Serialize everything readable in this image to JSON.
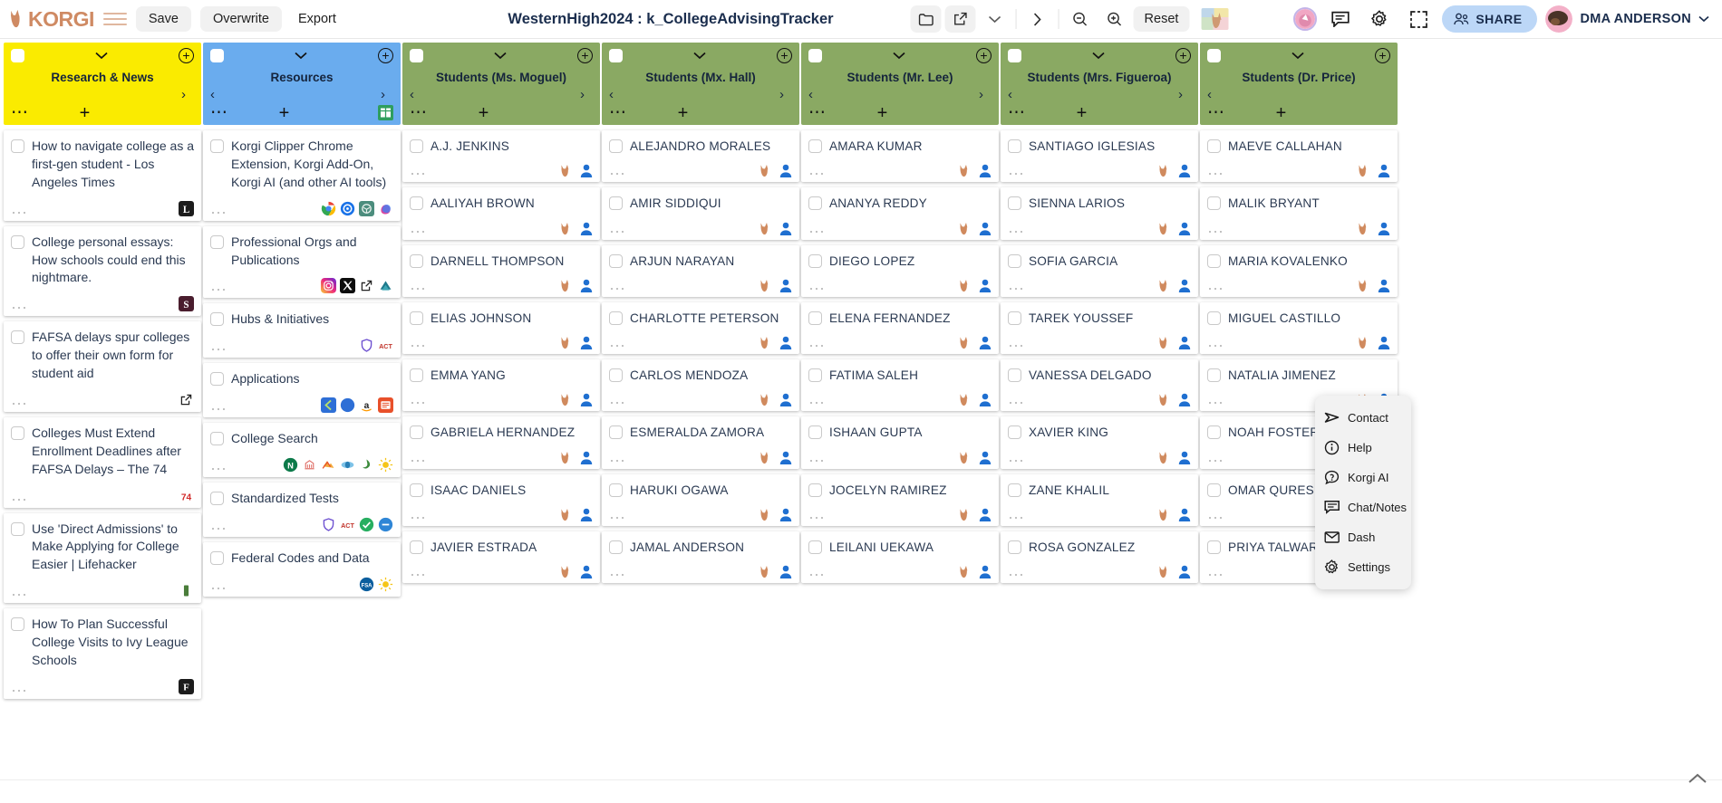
{
  "topbar": {
    "brand": "KORGI",
    "brand_icon": "fox-logo-icon",
    "menu_icon": "hamburger-menu-icon",
    "save_label": "Save",
    "overwrite_label": "Overwrite",
    "export_label": "Export",
    "doc_title": "WesternHigh2024 : k_CollegeAdvisingTracker",
    "folder_icon": "folder-icon",
    "open_external_icon": "open-external-icon",
    "chevron_down_icon": "chevron-down-icon",
    "chevron_right_icon": "chevron-right-icon",
    "zoom_out_icon": "zoom-out-icon",
    "zoom_in_icon": "zoom-in-icon",
    "reset_label": "Reset",
    "dog_thumb_icon": "dog-photo-thumbnail",
    "pink_avatar_icon": "pink-avatar-icon",
    "chat_icon": "chat-bubble-icon",
    "settings_icon": "gear-icon",
    "select_area_icon": "select-area-icon",
    "share_label": "SHARE",
    "share_icon": "people-icon",
    "user_name": "DMA ANDERSON",
    "user_avatar_icon": "user-avatar-icon",
    "user_caret_icon": "chevron-down-icon"
  },
  "colors": {
    "column_yellow": "#faeb00",
    "column_blue": "#6aacee",
    "column_green": "#8aa963",
    "share_blue": "#bcd7f7",
    "brand_orange": "#cf8a63",
    "title_navy": "#1a2d4d"
  },
  "columns": [
    {
      "title": "Research & News",
      "color": "#faeb00",
      "has_left_arrow": false,
      "has_right_arrow": true,
      "has_plus": true,
      "has_sheet_icon": false,
      "cards": [
        {
          "title": "How to navigate college as a first-gen student - Los Angeles Times",
          "badges": [
            "latimes-icon"
          ]
        },
        {
          "title": "College personal essays: How schools could end this nightmare.",
          "badges": [
            "slate-icon"
          ]
        },
        {
          "title": "FAFSA delays spur colleges to offer their own form for student aid",
          "badges": [
            "external-link-icon"
          ]
        },
        {
          "title": "Colleges Must Extend Enrollment Deadlines after FAFSA Delays – The 74",
          "badges": [
            "the74-icon"
          ]
        },
        {
          "title": "Use 'Direct Admissions' to Make Applying for College Easier | Lifehacker",
          "badges": [
            "lifehacker-icon"
          ]
        },
        {
          "title": "How To Plan Successful College Visits to Ivy League Schools",
          "badges": [
            "forbes-icon"
          ]
        }
      ]
    },
    {
      "title": "Resources",
      "color": "#6aacee",
      "has_left_arrow": true,
      "has_right_arrow": true,
      "has_plus": true,
      "has_sheet_icon": true,
      "cards": [
        {
          "title": "Korgi Clipper Chrome Extension, Korgi Add-On, Korgi AI (and other AI tools)",
          "badges": [
            "chrome-icon",
            "gemini-icon",
            "openai-icon",
            "copilot-icon"
          ]
        },
        {
          "title": "Professional Orgs and Publications",
          "badges": [
            "instagram-icon",
            "x-twitter-icon",
            "external-link-icon",
            "nacac-icon"
          ]
        },
        {
          "title": "Hubs & Initiatives",
          "badges": [
            "shield-icon",
            "act-icon"
          ]
        },
        {
          "title": "Applications",
          "badges": [
            "commonapp-icon",
            "coalition-icon",
            "amazon-icon",
            "scoir-icon"
          ]
        },
        {
          "title": "College Search",
          "badges": [
            "niche-icon",
            "bigfuture-icon",
            "cappex-icon",
            "unigo-icon",
            "petersons-icon",
            "sunshine-icon"
          ]
        },
        {
          "title": "Standardized Tests",
          "badges": [
            "shield-icon",
            "act-icon",
            "checkmark-icon",
            "minus-icon"
          ]
        },
        {
          "title": "Federal Codes and Data",
          "badges": [
            "fsa-icon",
            "sunshine-icon"
          ]
        }
      ]
    },
    {
      "title": "Students (Ms. Moguel)",
      "color": "#8aa963",
      "has_left_arrow": true,
      "has_right_arrow": true,
      "has_plus": true,
      "has_sheet_icon": false,
      "cards": [
        {
          "title": "A.J. JENKINS",
          "student": true
        },
        {
          "title": "AALIYAH BROWN",
          "student": true
        },
        {
          "title": "DARNELL THOMPSON",
          "student": true
        },
        {
          "title": "ELIAS JOHNSON",
          "student": true
        },
        {
          "title": "EMMA YANG",
          "student": true
        },
        {
          "title": "GABRIELA HERNANDEZ",
          "student": true
        },
        {
          "title": "ISAAC DANIELS",
          "student": true
        },
        {
          "title": "JAVIER ESTRADA",
          "student": true
        }
      ]
    },
    {
      "title": "Students (Mx. Hall)",
      "color": "#8aa963",
      "has_left_arrow": true,
      "has_right_arrow": true,
      "has_plus": true,
      "has_sheet_icon": false,
      "cards": [
        {
          "title": "ALEJANDRO MORALES",
          "student": true
        },
        {
          "title": "AMIR SIDDIQUI",
          "student": true
        },
        {
          "title": "ARJUN NARAYAN",
          "student": true
        },
        {
          "title": "CHARLOTTE PETERSON",
          "student": true
        },
        {
          "title": "CARLOS MENDOZA",
          "student": true
        },
        {
          "title": "ESMERALDA ZAMORA",
          "student": true
        },
        {
          "title": "HARUKI OGAWA",
          "student": true
        },
        {
          "title": "JAMAL ANDERSON",
          "student": true
        }
      ]
    },
    {
      "title": "Students (Mr. Lee)",
      "color": "#8aa963",
      "has_left_arrow": true,
      "has_right_arrow": true,
      "has_plus": true,
      "has_sheet_icon": false,
      "cards": [
        {
          "title": "AMARA KUMAR",
          "student": true
        },
        {
          "title": "ANANYA REDDY",
          "student": true
        },
        {
          "title": "DIEGO LOPEZ",
          "student": true
        },
        {
          "title": "ELENA FERNANDEZ",
          "student": true
        },
        {
          "title": "FATIMA SALEH",
          "student": true
        },
        {
          "title": "ISHAAN GUPTA",
          "student": true
        },
        {
          "title": "JOCELYN RAMIREZ",
          "student": true
        },
        {
          "title": "LEILANI UEKAWA",
          "student": true
        }
      ]
    },
    {
      "title": "Students (Mrs. Figueroa)",
      "color": "#8aa963",
      "has_left_arrow": true,
      "has_right_arrow": true,
      "has_plus": true,
      "has_sheet_icon": false,
      "cards": [
        {
          "title": "SANTIAGO IGLESIAS",
          "student": true
        },
        {
          "title": "SIENNA LARIOS",
          "student": true
        },
        {
          "title": "SOFIA GARCIA",
          "student": true
        },
        {
          "title": "TAREK YOUSSEF",
          "student": true
        },
        {
          "title": "VANESSA DELGADO",
          "student": true
        },
        {
          "title": "XAVIER KING",
          "student": true
        },
        {
          "title": "ZANE KHALIL",
          "student": true
        },
        {
          "title": "ROSA GONZALEZ",
          "student": true
        }
      ]
    },
    {
      "title": "Students (Dr. Price)",
      "color": "#8aa963",
      "has_left_arrow": true,
      "has_right_arrow": false,
      "has_plus": true,
      "has_sheet_icon": false,
      "cards": [
        {
          "title": "MAEVE CALLAHAN",
          "student": true
        },
        {
          "title": "MALIK BRYANT",
          "student": true
        },
        {
          "title": "MARIA KOVALENKO",
          "student": true
        },
        {
          "title": "MIGUEL CASTILLO",
          "student": true
        },
        {
          "title": "NATALIA JIMENEZ",
          "student": true
        },
        {
          "title": "NOAH FOSTER",
          "student": true
        },
        {
          "title": "OMAR QURESHI",
          "student": true
        },
        {
          "title": "PRIYA TALWAR",
          "student": true
        }
      ]
    }
  ],
  "context_menu": {
    "items": [
      {
        "label": "Contact",
        "icon": "send-paper-plane-icon"
      },
      {
        "label": "Help",
        "icon": "info-circle-icon"
      },
      {
        "label": "Korgi AI",
        "icon": "question-chat-icon"
      },
      {
        "label": "Chat/Notes",
        "icon": "chat-bubble-icon"
      },
      {
        "label": "Dash",
        "icon": "mail-icon"
      },
      {
        "label": "Settings",
        "icon": "gear-icon"
      }
    ]
  },
  "scroll_up_icon": "chevron-up-icon"
}
